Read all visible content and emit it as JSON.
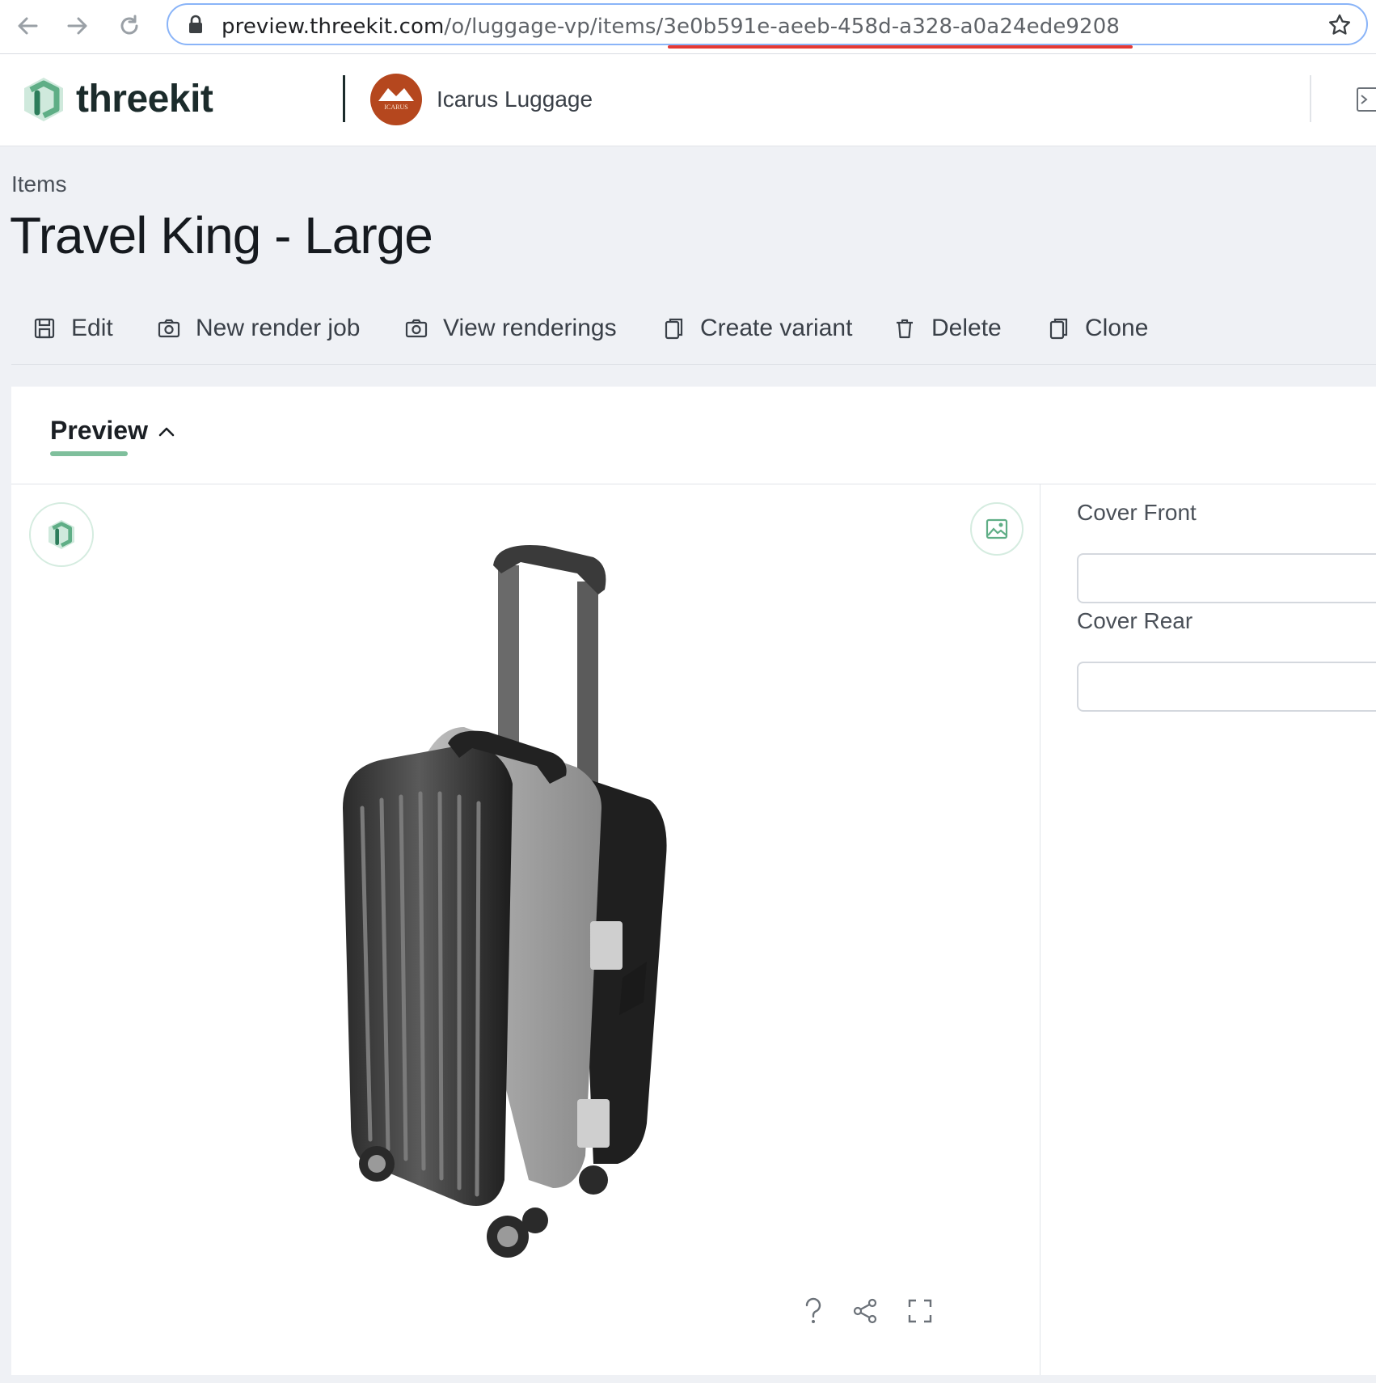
{
  "browser": {
    "url_host": "preview.threekit.com",
    "url_path": "/o/luggage-vp/items/3e0b591e-aeeb-458d-a328-a0a24ede9208"
  },
  "header": {
    "brand": "threekit",
    "org_name": "Icarus Luggage",
    "org_avatar_text": "ICARUS"
  },
  "page": {
    "breadcrumb": "Items",
    "title": "Travel King - Large"
  },
  "toolbar": {
    "edit": "Edit",
    "new_render_job": "New render job",
    "view_renderings": "View renderings",
    "create_variant": "Create variant",
    "delete": "Delete",
    "clone": "Clone"
  },
  "tabs": {
    "preview": "Preview"
  },
  "attributes": {
    "cover_front_label": "Cover Front",
    "cover_front_value": "",
    "cover_rear_label": "Cover Rear",
    "cover_rear_value": ""
  },
  "colors": {
    "accent_green": "#7fbf9c",
    "brand_dark": "#1b2b2b",
    "org_avatar": "#b5471e",
    "url_annotation": "#e53935"
  },
  "icons": [
    "back-arrow-icon",
    "forward-arrow-icon",
    "reload-icon",
    "lock-icon",
    "star-icon",
    "threekit-logo-icon",
    "terminal-icon",
    "save-icon",
    "camera-icon",
    "copy-icon",
    "trash-icon",
    "chevron-up-icon",
    "image-icon",
    "help-icon",
    "share-icon",
    "fullscreen-icon"
  ]
}
